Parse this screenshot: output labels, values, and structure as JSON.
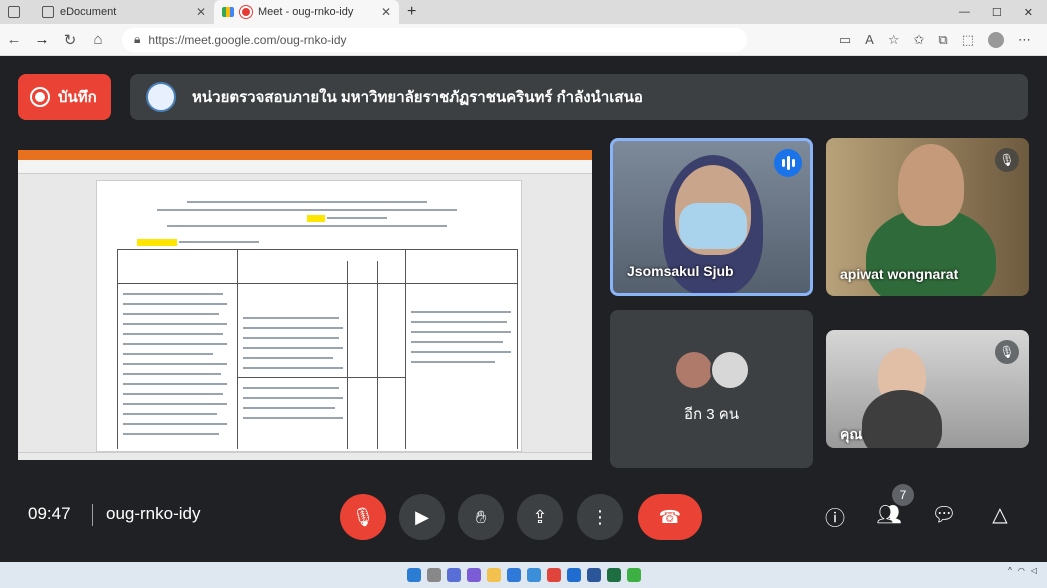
{
  "browser": {
    "tabs": [
      {
        "title": "eDocument",
        "active": false
      },
      {
        "title": "Meet - oug-rnko-idy",
        "active": true
      }
    ],
    "url": "https://meet.google.com/oug-rnko-idy"
  },
  "meet": {
    "record_label": "บันทึก",
    "presenter_banner": "หน่วยตรวจสอบภายใน มหาวิทยาลัยราชภัฏราชนครินทร์ กำลังนำเสนอ",
    "participants": [
      {
        "name": "Jsomsakul Sjub",
        "speaking": true,
        "muted": false
      },
      {
        "name": "apiwat wongnarat",
        "speaking": false,
        "muted": true
      },
      {
        "name": "คุณ",
        "speaking": false,
        "muted": true
      }
    ],
    "others_label": "อีก 3 คน",
    "clock": "09:47",
    "meeting_code": "oug-rnko-idy",
    "participant_count": "7"
  },
  "colors": {
    "background": "#202124",
    "tile": "#3c4043",
    "record_red": "#ea4335",
    "speaking_blue": "#1a73e8"
  }
}
